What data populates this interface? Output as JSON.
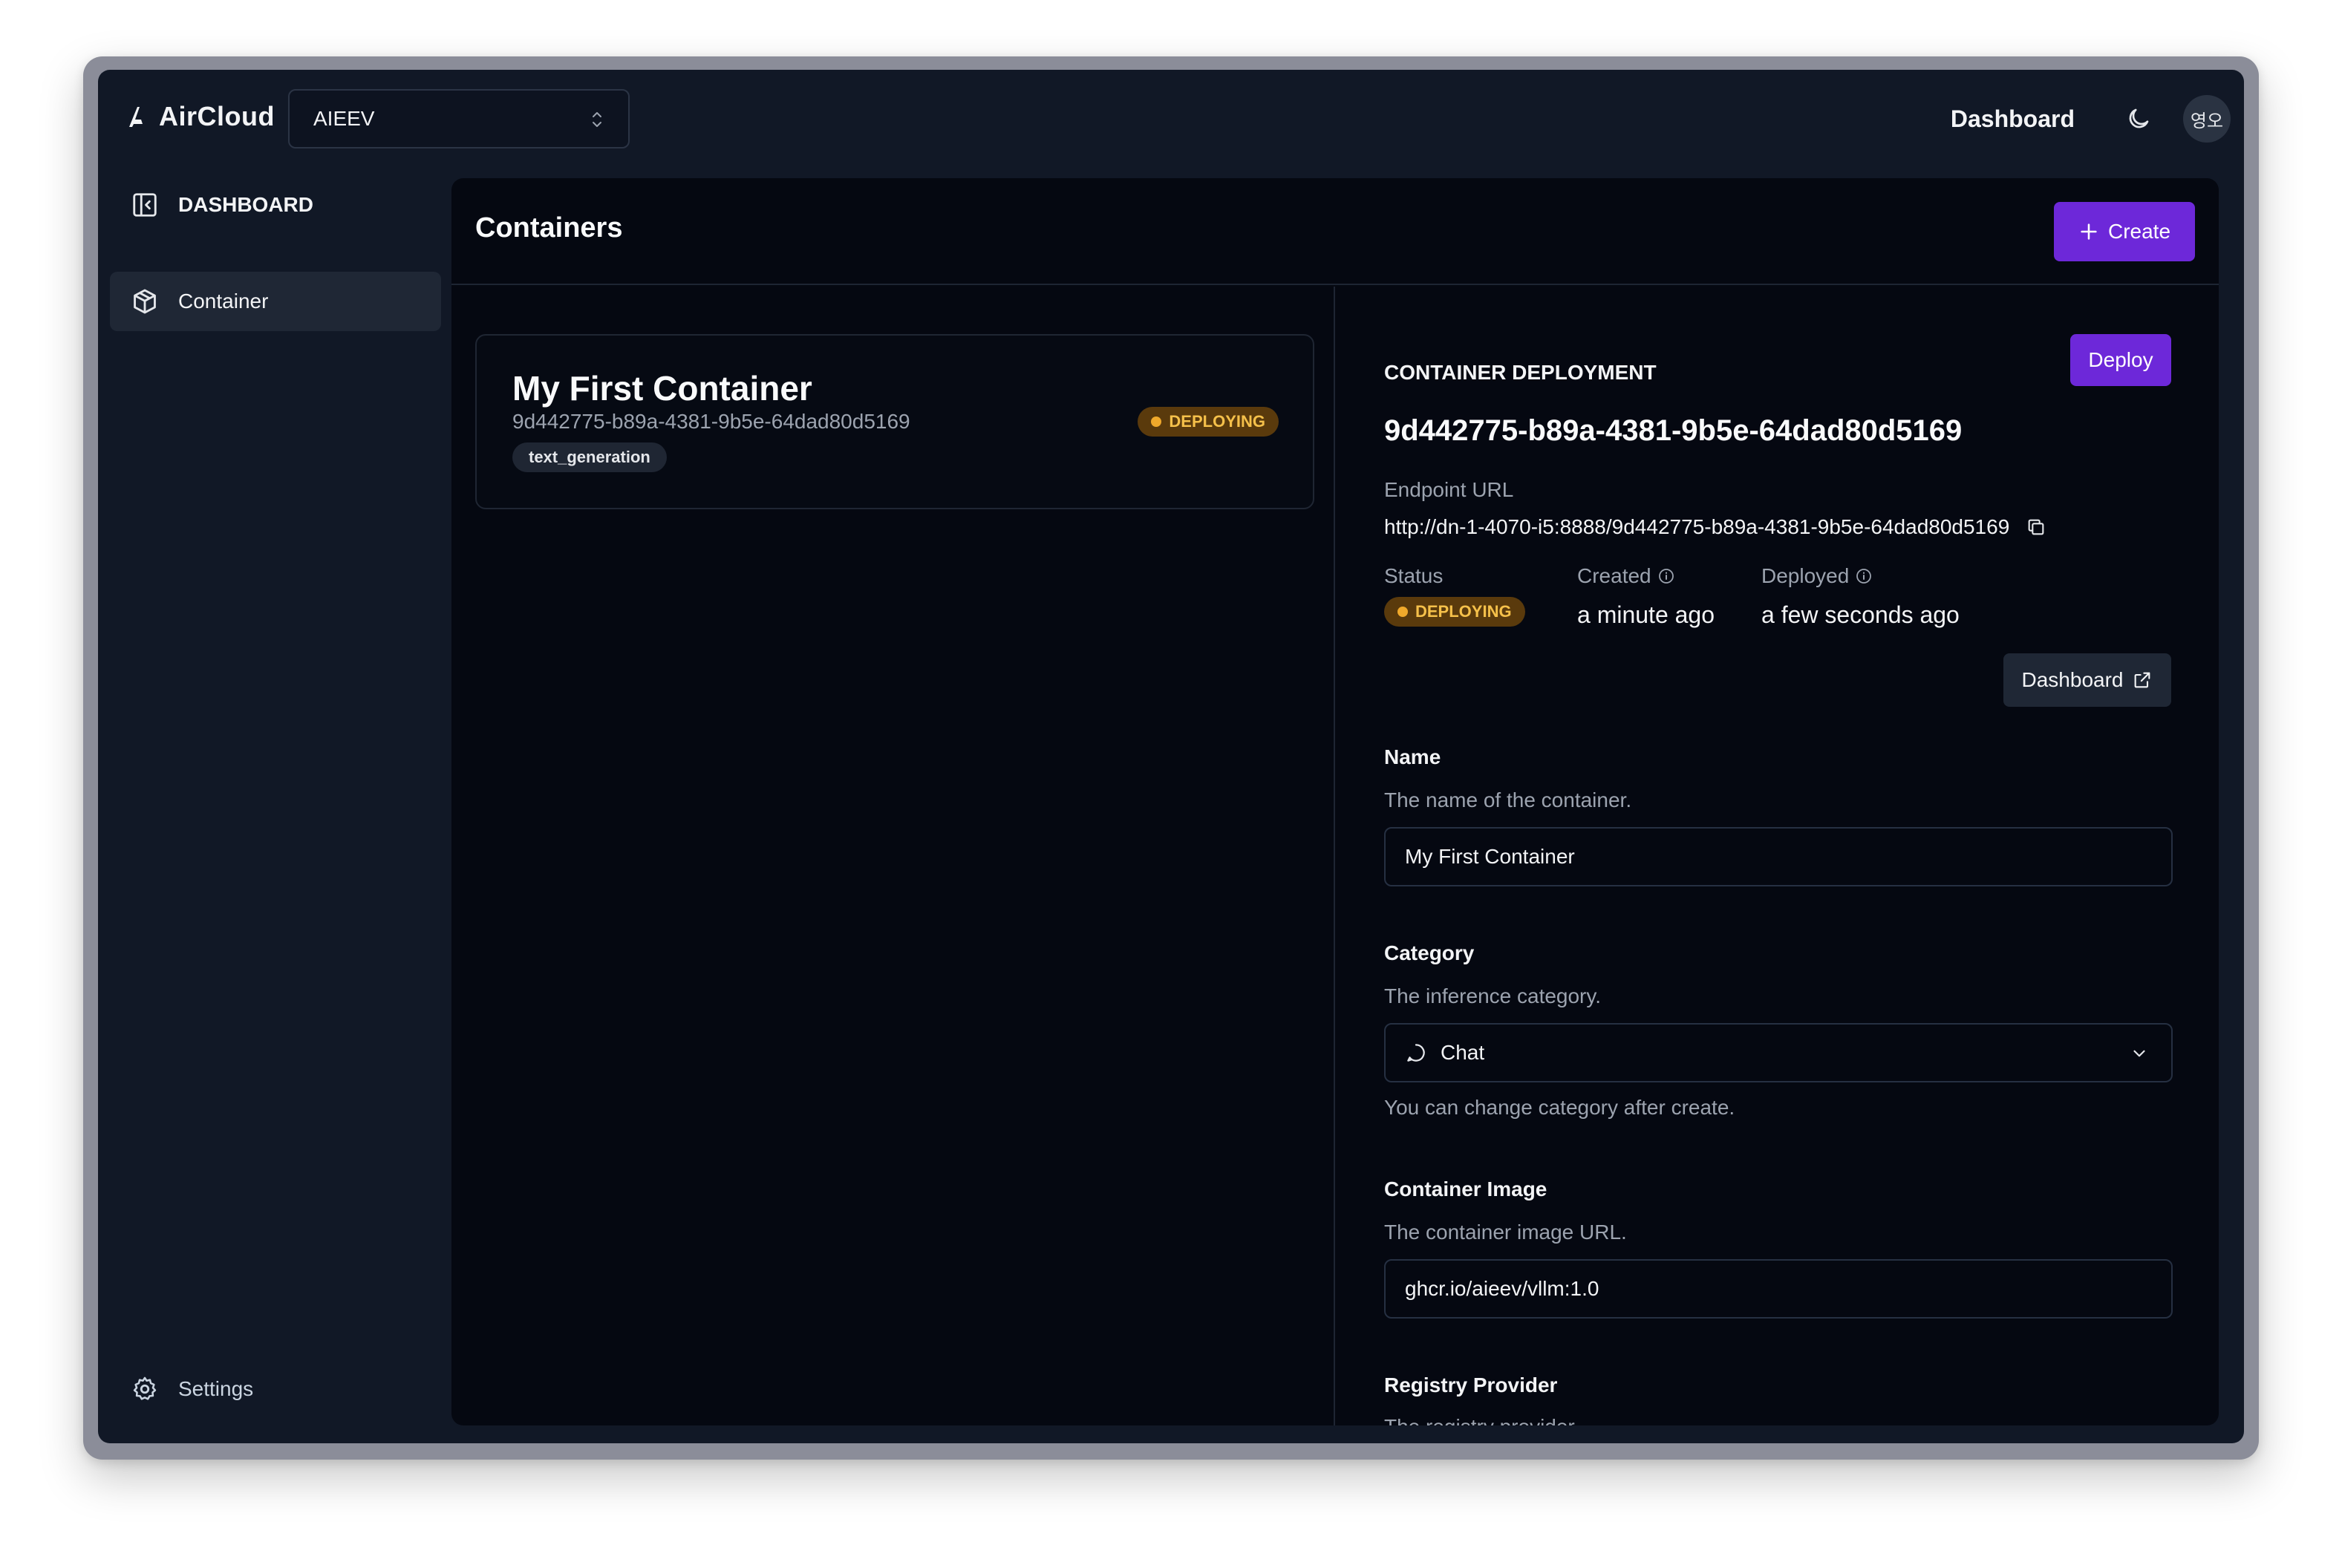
{
  "app": {
    "brand": "AirCloud",
    "org_selector": {
      "value": "AIEEV"
    },
    "nav_link": "Dashboard",
    "avatar_initials": "영오"
  },
  "sidebar": {
    "header_label": "DASHBOARD",
    "items": [
      {
        "label": "Container",
        "icon": "cube-icon",
        "active": true
      }
    ],
    "settings_label": "Settings"
  },
  "main": {
    "title": "Containers",
    "create_label": "Create"
  },
  "containers": [
    {
      "name": "My First Container",
      "id": "9d442775-b89a-4381-9b5e-64dad80d5169",
      "tag": "text_generation",
      "status": "DEPLOYING"
    }
  ],
  "detail": {
    "section_label": "CONTAINER DEPLOYMENT",
    "deploy_label": "Deploy",
    "id": "9d442775-b89a-4381-9b5e-64dad80d5169",
    "endpoint_label": "Endpoint URL",
    "endpoint_url": "http://dn-1-4070-i5:8888/9d442775-b89a-4381-9b5e-64dad80d5169",
    "status_label": "Status",
    "status_value": "DEPLOYING",
    "created_label": "Created",
    "created_value": "a minute ago",
    "deployed_label": "Deployed",
    "deployed_value": "a few seconds ago",
    "dashboard_button": "Dashboard",
    "fields": {
      "name": {
        "label": "Name",
        "help": "The name of the container.",
        "value": "My First Container"
      },
      "category": {
        "label": "Category",
        "help": "The inference category.",
        "value": "Chat",
        "note": "You can change category after create."
      },
      "image": {
        "label": "Container Image",
        "help": "The container image URL.",
        "value": "ghcr.io/aieev/vllm:1.0"
      },
      "registry": {
        "label": "Registry Provider",
        "help": "The registry provider."
      }
    }
  },
  "colors": {
    "accent": "#6d28d9",
    "status_deploying_bg": "#5a3a0c",
    "status_deploying_text": "#f5c04a",
    "panel_bg": "#050811",
    "shell_bg": "#111826"
  }
}
